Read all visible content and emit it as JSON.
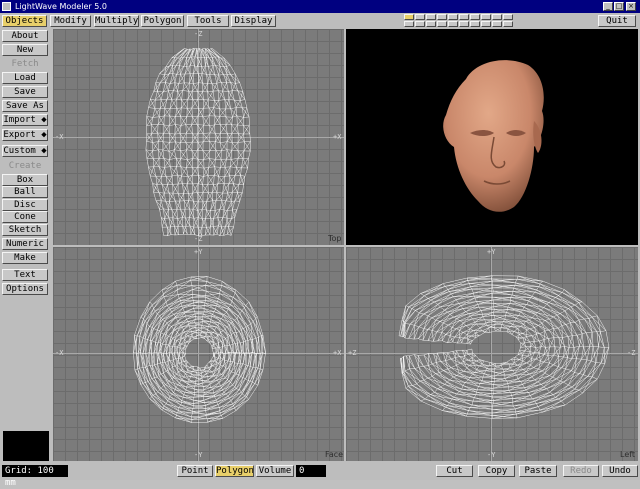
{
  "window": {
    "title": "LightWave Modeler 5.0",
    "controls": [
      "_",
      "□",
      "×"
    ]
  },
  "menubar": {
    "tabs": [
      {
        "label": "Objects",
        "active": true
      },
      {
        "label": "Modify",
        "active": false
      },
      {
        "label": "Multiply",
        "active": false
      },
      {
        "label": "Polygon",
        "active": false
      },
      {
        "label": "Tools",
        "active": false
      },
      {
        "label": "Display",
        "active": false
      }
    ],
    "quit_label": "Quit"
  },
  "sidebar": {
    "items": [
      {
        "label": "About",
        "type": "button"
      },
      {
        "label": "New",
        "type": "button"
      },
      {
        "label": "Fetch",
        "type": "disabled"
      },
      {
        "label": "Load",
        "type": "button"
      },
      {
        "label": "Save",
        "type": "button"
      },
      {
        "label": "Save As",
        "type": "button"
      },
      {
        "label": "Import ◆",
        "type": "button"
      },
      {
        "label": "Export ◆",
        "type": "button"
      },
      {
        "label": "Custom ◆",
        "type": "button"
      },
      {
        "label": "Create",
        "type": "section"
      },
      {
        "label": "Box",
        "type": "button"
      },
      {
        "label": "Ball",
        "type": "button"
      },
      {
        "label": "Disc",
        "type": "button"
      },
      {
        "label": "Cone",
        "type": "button"
      },
      {
        "label": "Sketch",
        "type": "button"
      },
      {
        "label": "Numeric",
        "type": "button"
      },
      {
        "label": "Make",
        "type": "button"
      },
      {
        "label": "Text",
        "type": "button"
      },
      {
        "label": "Options",
        "type": "button"
      }
    ]
  },
  "viewports": {
    "top": {
      "label": "Top",
      "axes": {
        "top": "-Z",
        "bottom": "-Z",
        "left": "-X",
        "right": "+X"
      }
    },
    "face": {
      "label": "Face",
      "axes": {
        "top": "+Y",
        "bottom": "-Y",
        "left": "-X",
        "right": "+X"
      }
    },
    "left": {
      "label": "Left",
      "axes": {
        "top": "+Y",
        "bottom": "-Y",
        "left": "+Z",
        "right": "-Z"
      }
    },
    "perspective": {
      "background": "#000000",
      "skin": "#c9876a"
    }
  },
  "statusbar": {
    "grid_text": "Grid: 100 mm",
    "selection_modes": [
      {
        "label": "Point",
        "active": false
      },
      {
        "label": "Polygon",
        "active": true
      },
      {
        "label": "Volume",
        "active": false
      }
    ],
    "selection_count": "0",
    "edit_buttons": [
      {
        "label": "Cut",
        "enabled": true
      },
      {
        "label": "Copy",
        "enabled": true
      },
      {
        "label": "Paste",
        "enabled": true
      },
      {
        "label": "Redo",
        "enabled": false
      },
      {
        "label": "Undo",
        "enabled": true
      }
    ]
  },
  "colors": {
    "titlebar": "#000080",
    "active_button": "#e8cf6a",
    "viewport_bg": "#7b7b7b",
    "wireframe": "#ffffff"
  }
}
